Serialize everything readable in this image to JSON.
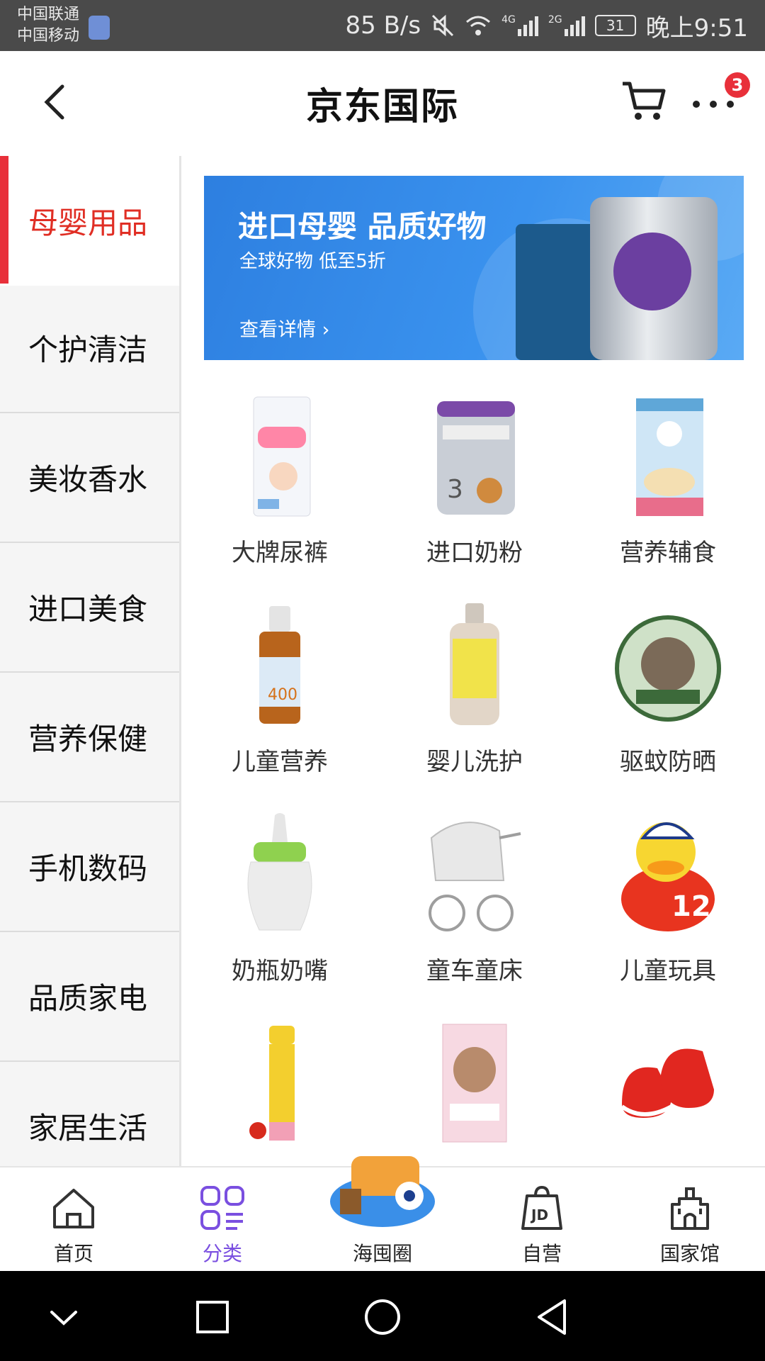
{
  "status_bar": {
    "carrier1": "中国联通",
    "carrier2": "中国移动",
    "net_speed": "85 B/s",
    "net1": "4G",
    "net2": "2G",
    "battery": "31",
    "time": "晚上9:51"
  },
  "header": {
    "title": "京东国际",
    "badge_count": "3"
  },
  "sidebar": {
    "items": [
      {
        "label": "母婴用品",
        "active": true
      },
      {
        "label": "个护清洁"
      },
      {
        "label": "美妆香水"
      },
      {
        "label": "进口美食"
      },
      {
        "label": "营养保健"
      },
      {
        "label": "手机数码"
      },
      {
        "label": "品质家电"
      },
      {
        "label": "家居生活"
      }
    ]
  },
  "banner": {
    "headline": "进口母婴 品质好物",
    "subline": "全球好物 低至5折",
    "cta": "查看详情 ›"
  },
  "products": [
    {
      "label": "大牌尿裤",
      "icon": "diaper-pack-icon"
    },
    {
      "label": "进口奶粉",
      "icon": "milk-powder-can-icon"
    },
    {
      "label": "营养辅食",
      "icon": "cereal-can-icon"
    },
    {
      "label": "儿童营养",
      "icon": "vitamin-drops-icon"
    },
    {
      "label": "婴儿洗护",
      "icon": "shampoo-bottle-icon"
    },
    {
      "label": "驱蚊防晒",
      "icon": "ointment-tin-icon"
    },
    {
      "label": "奶瓶奶嘴",
      "icon": "baby-bottle-icon"
    },
    {
      "label": "童车童床",
      "icon": "pram-icon"
    },
    {
      "label": "儿童玩具",
      "icon": "rubber-duck-icon"
    },
    {
      "label": "",
      "icon": "lip-balm-icon"
    },
    {
      "label": "",
      "icon": "tea-box-icon"
    },
    {
      "label": "",
      "icon": "baby-shoes-icon"
    }
  ],
  "bottom_nav": {
    "items": [
      {
        "label": "首页",
        "icon": "home-icon"
      },
      {
        "label": "分类",
        "icon": "category-icon",
        "active": true
      },
      {
        "label": "海囤圈",
        "icon": "festival-promo-icon"
      },
      {
        "label": "自营",
        "icon": "jd-bag-icon"
      },
      {
        "label": "国家馆",
        "icon": "castle-icon"
      }
    ]
  },
  "colors": {
    "accent_red": "#e8303a",
    "active_purple": "#7a4fe0",
    "banner_blue": "#3a92ee"
  }
}
